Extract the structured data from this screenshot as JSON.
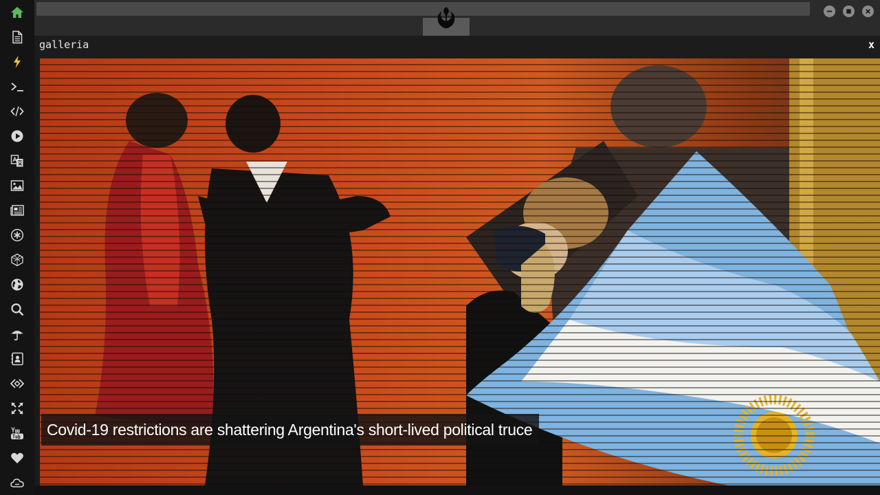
{
  "sidebar": {
    "items": [
      {
        "icon": "home-icon",
        "active": true
      },
      {
        "icon": "document-icon"
      },
      {
        "icon": "lightning-icon",
        "accent": true
      },
      {
        "icon": "terminal-icon"
      },
      {
        "icon": "code-icon"
      },
      {
        "icon": "play-icon"
      },
      {
        "icon": "translate-icon"
      },
      {
        "icon": "image-icon"
      },
      {
        "icon": "newspaper-icon"
      },
      {
        "icon": "asterisk-icon"
      },
      {
        "icon": "cube-icon"
      },
      {
        "icon": "globe-icon"
      },
      {
        "icon": "search-icon"
      },
      {
        "icon": "umbrella-icon"
      },
      {
        "icon": "contact-icon"
      },
      {
        "icon": "code-diamond-icon"
      },
      {
        "icon": "expand-icon"
      },
      {
        "icon": "youtube-icon"
      },
      {
        "icon": "heart-icon"
      },
      {
        "icon": "cloud-icon"
      }
    ],
    "colors": {
      "default": "#d8d8d8",
      "active": "#5cb85c",
      "accent": "#f0c040"
    }
  },
  "window": {
    "title": "galleria",
    "close_label": "x"
  },
  "gallery": {
    "caption": "Covid-19 restrictions are shattering Argentina's short-lived political truce"
  }
}
